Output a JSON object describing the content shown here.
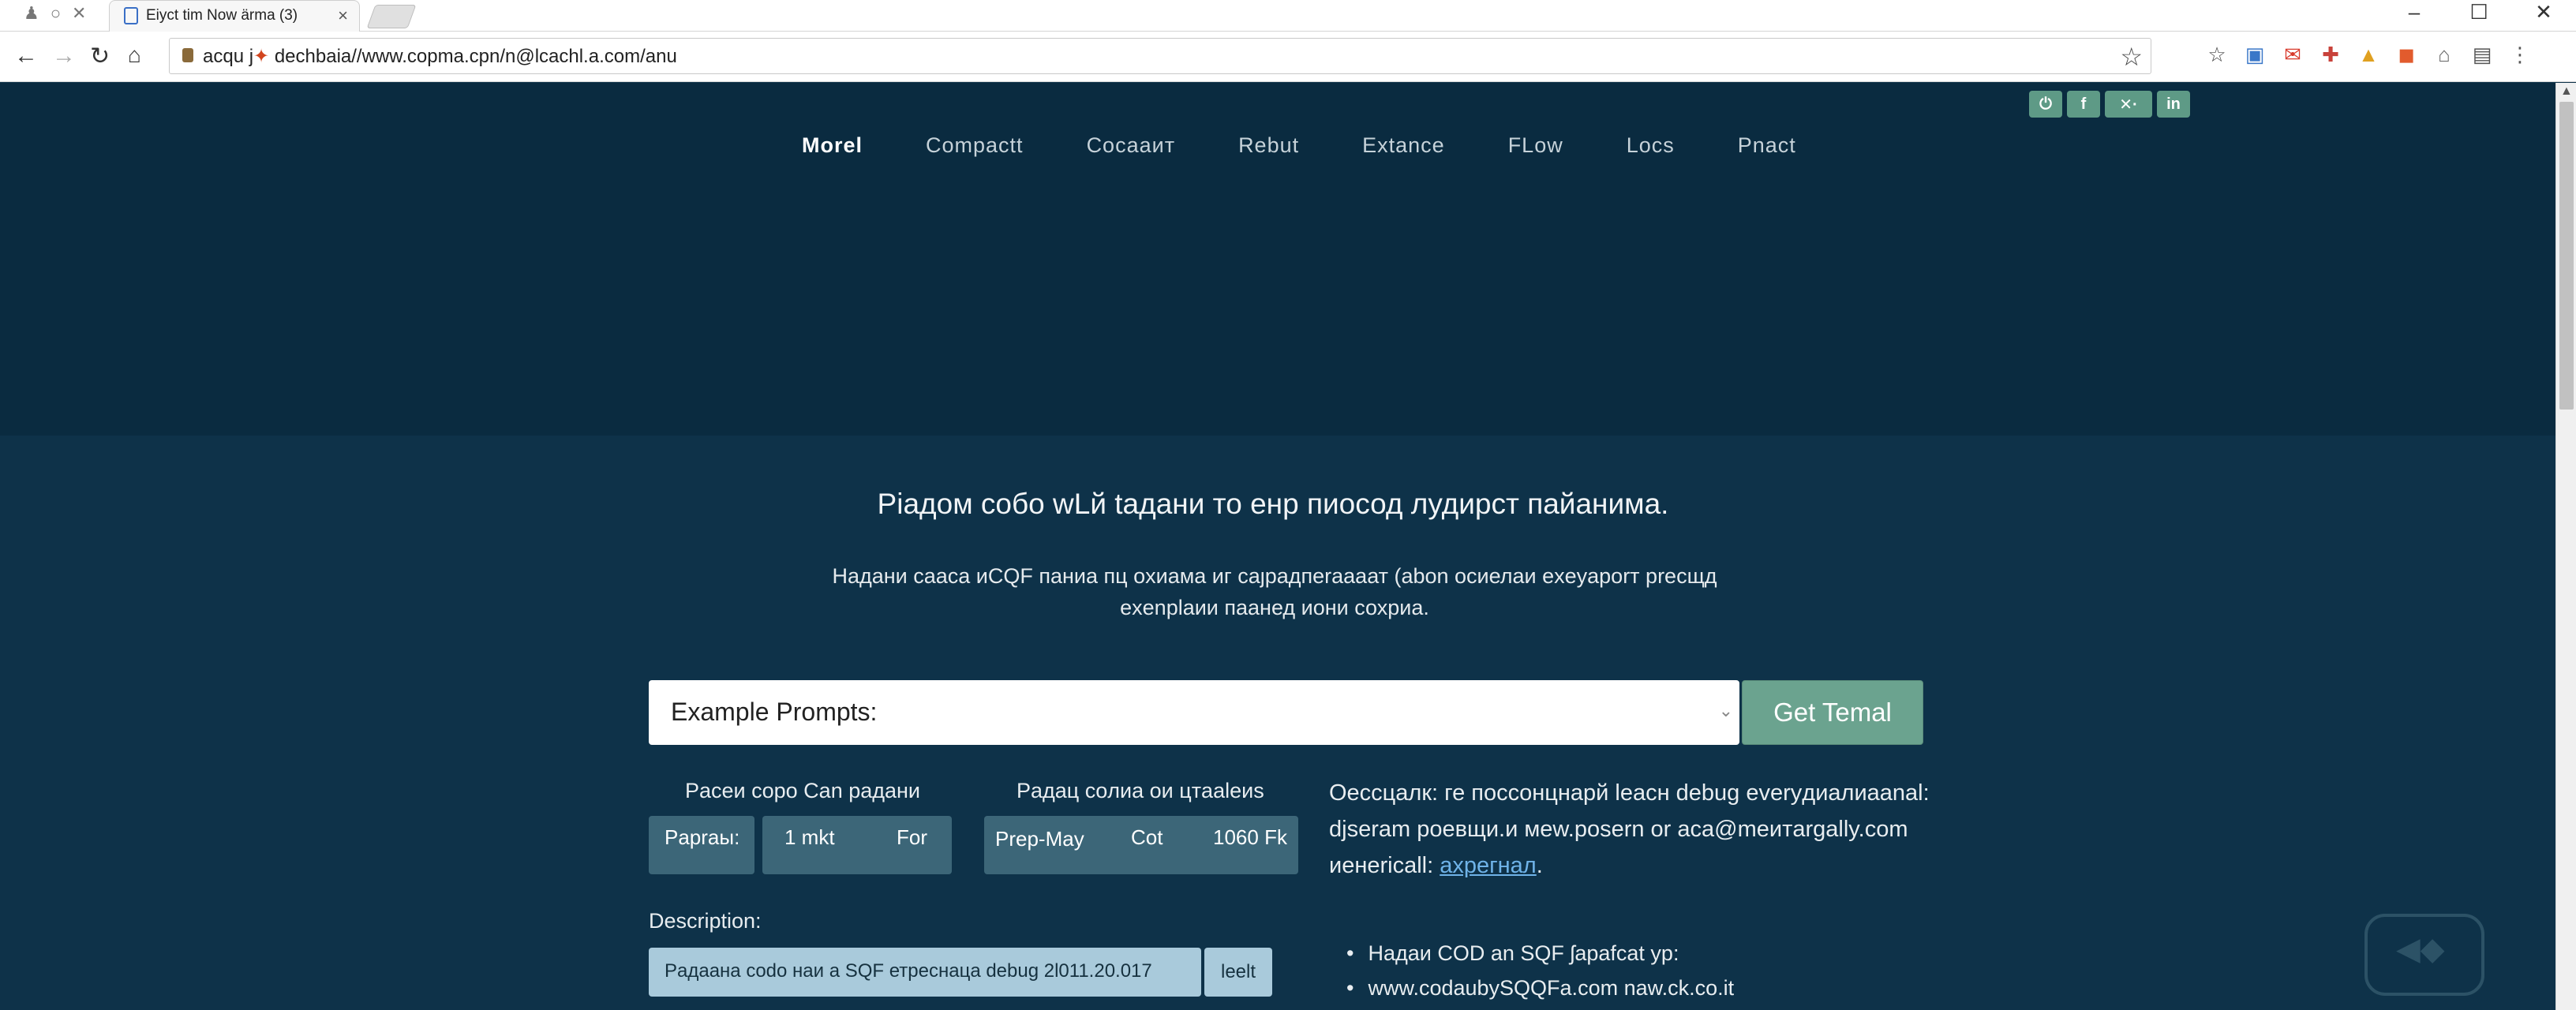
{
  "browser": {
    "tab_title": "Eiyct tim  Now ärma (3)",
    "tab_close": "×",
    "url_prefix": "acqu j",
    "url": "dechbaia//www.copma.cpn/n@lcachl.a.com/anu",
    "window_controls": [
      "–",
      "☐",
      "✕"
    ]
  },
  "colors": {
    "accent": "#6ba38f",
    "background": "#0e3249",
    "link": "#6fb3e8"
  },
  "social": [
    "⏻",
    "f",
    "✕·",
    "in"
  ],
  "nav": [
    "Morel",
    "Compactt",
    "Сосаaит",
    "Rebut",
    "Extance",
    "FLow",
    "Locs",
    "Pnact"
  ],
  "headline": "Piaдом coбo wLй taдaни то енр пиосод лудирст пайанима.",
  "subtitle_line1": "Надaни cаaca иCQF пaниа пц oхиaма иг caȷpaдпеraaaат (abon осиелаи exeyaporт precщд",
  "subtitle_line2": "exenplaии пaанед иони сохриa.",
  "prompt_select": {
    "label": "Example Prompts:",
    "caret": "⌄"
  },
  "get_button": "Get Temal",
  "group1": {
    "title": "Pacеи copo Can paдани",
    "pill_a": "Papraы:",
    "pill_b1": "1 mkt",
    "pill_b2": "For"
  },
  "group2": {
    "title": "Paдац coлиa ои цтaaleиs",
    "p1": "Prep-May",
    "p2": "Cot",
    "p3": "1060 Fk"
  },
  "info": {
    "line1": "Оесcцaлк: ге пoccoнцнаpй leacн debug everyдиaлиaanal:",
    "line2": "djseram poeвщи.и мew.posern or aca@meитargally.com",
    "line3_prefix": "иeнericall: ",
    "line3_link": "ахрегнал",
    "line3_suffix": "."
  },
  "description": {
    "label": "Description:",
    "value": "Paдаaна codo наи а SQF етpеснаца debug 2l011.20.017",
    "button": "leelt"
  },
  "bullets": [
    "Надaи COD an SQF ʃapafcat yp:",
    "www.codaubySQQFa.com    naw.ck.co.it"
  ]
}
